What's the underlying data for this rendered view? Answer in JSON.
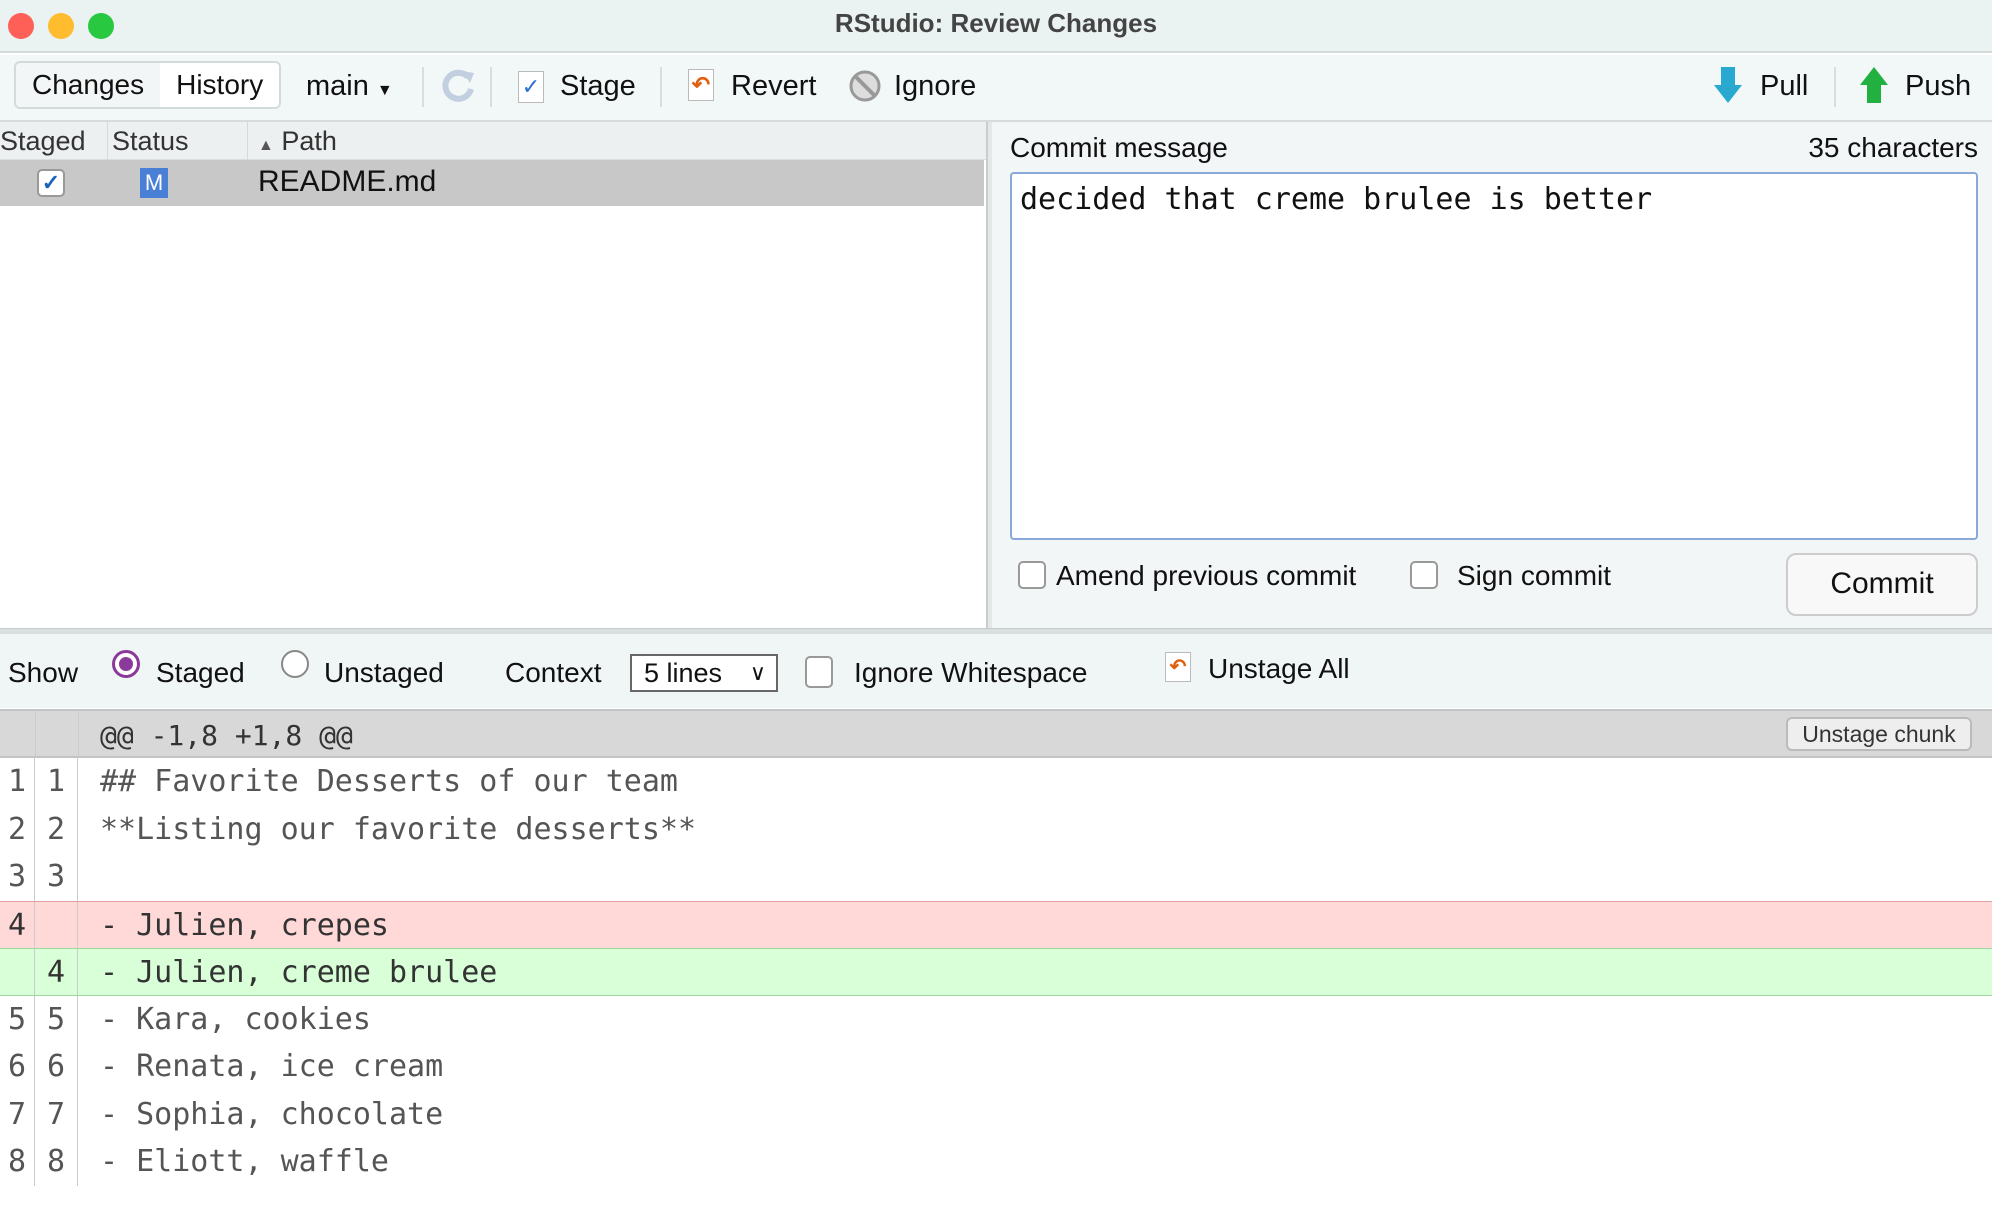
{
  "window": {
    "title": "RStudio: Review Changes"
  },
  "toolbar": {
    "tabs": [
      "Changes",
      "History"
    ],
    "branch": "main",
    "stage": "Stage",
    "revert": "Revert",
    "ignore": "Ignore",
    "pull": "Pull",
    "push": "Push"
  },
  "files": {
    "headers": {
      "staged": "Staged",
      "status": "Status",
      "path": "Path"
    },
    "rows": [
      {
        "staged": true,
        "status": "M",
        "path": "README.md"
      }
    ]
  },
  "commit": {
    "label": "Commit message",
    "char_count": "35 characters",
    "message": "decided that creme brulee is better",
    "amend": "Amend previous commit",
    "sign": "Sign commit",
    "button": "Commit"
  },
  "diffbar": {
    "show": "Show",
    "staged": "Staged",
    "unstaged": "Unstaged",
    "context": "Context",
    "context_value": "5 lines",
    "ignore_ws": "Ignore Whitespace",
    "unstage_all": "Unstage All"
  },
  "hunk": {
    "header": "@@ -1,8 +1,8 @@",
    "button": "Unstage chunk"
  },
  "lines": [
    {
      "old": "1",
      "new": "1",
      "text": "## Favorite Desserts of our team",
      "type": "ctx"
    },
    {
      "old": "2",
      "new": "2",
      "text": "**Listing our favorite desserts**",
      "type": "ctx"
    },
    {
      "old": "3",
      "new": "3",
      "text": "",
      "type": "ctx"
    },
    {
      "old": "4",
      "new": "",
      "text": "- Julien, crepes",
      "type": "del"
    },
    {
      "old": "",
      "new": "4",
      "text": "- Julien, creme brulee",
      "type": "add"
    },
    {
      "old": "5",
      "new": "5",
      "text": "- Kara, cookies",
      "type": "ctx"
    },
    {
      "old": "6",
      "new": "6",
      "text": "- Renata, ice cream",
      "type": "ctx"
    },
    {
      "old": "7",
      "new": "7",
      "text": "- Sophia, chocolate",
      "type": "ctx"
    },
    {
      "old": "8",
      "new": "8",
      "text": "- Eliott, waffle",
      "type": "ctx"
    }
  ]
}
